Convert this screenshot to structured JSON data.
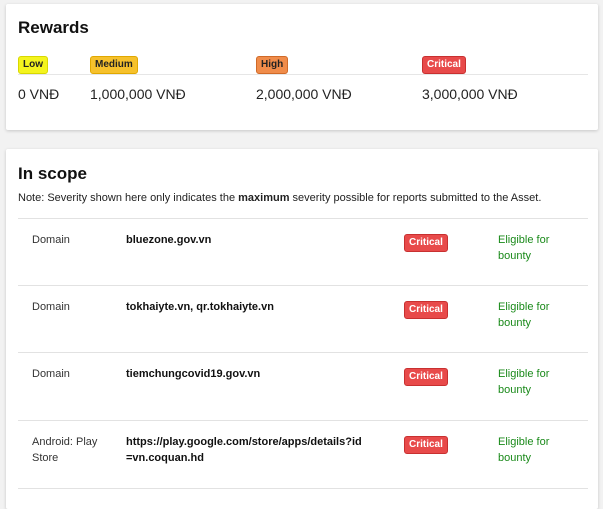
{
  "rewards": {
    "title": "Rewards",
    "tiers": [
      {
        "severity": "Low",
        "amount": "0 VNĐ"
      },
      {
        "severity": "Medium",
        "amount": "1,000,000 VNĐ"
      },
      {
        "severity": "High",
        "amount": "2,000,000 VNĐ"
      },
      {
        "severity": "Critical",
        "amount": "3,000,000 VNĐ"
      }
    ]
  },
  "scope": {
    "title": "In scope",
    "note_prefix": "Note: Severity shown here only indicates the ",
    "note_bold": "maximum",
    "note_suffix": " severity possible for reports submitted to the Asset.",
    "assets": [
      {
        "type": "Domain",
        "asset": "bluezone.gov.vn",
        "severity": "Critical",
        "eligibility": "Eligible for bounty"
      },
      {
        "type": "Domain",
        "asset": "tokhaiyte.vn, qr.tokhaiyte.vn",
        "severity": "Critical",
        "eligibility": "Eligible for bounty"
      },
      {
        "type": "Domain",
        "asset": "tiemchungcovid19.gov.vn",
        "severity": "Critical",
        "eligibility": "Eligible for bounty"
      },
      {
        "type": "Android: Play Store",
        "asset": "https://play.google.com/store/apps/details?id=vn.coquan.hd",
        "severity": "Critical",
        "eligibility": "Eligible for bounty"
      }
    ]
  }
}
